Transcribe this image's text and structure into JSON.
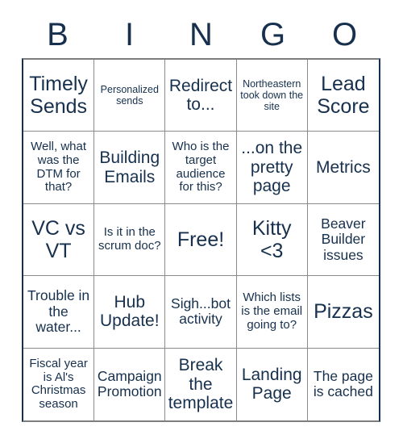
{
  "card": {
    "title": "BINGO",
    "text_color": "#16304d",
    "grid_line_color": "#8a8a8a",
    "background": "#ffffff",
    "header_letters": [
      "B",
      "I",
      "N",
      "G",
      "O"
    ],
    "columns": 5,
    "rows": 5,
    "cells": [
      {
        "text": "Timely Sends",
        "size": "xl"
      },
      {
        "text": "Personalized sends",
        "size": "xs"
      },
      {
        "text": "Redirect to...",
        "size": "l"
      },
      {
        "text": "Northeastern took down the site",
        "size": "xs"
      },
      {
        "text": "Lead Score",
        "size": "xl"
      },
      {
        "text": "Well, what was the DTM for that?",
        "size": "s"
      },
      {
        "text": "Building Emails",
        "size": "l"
      },
      {
        "text": "Who is the target audience for this?",
        "size": "s"
      },
      {
        "text": "...on the pretty page",
        "size": "l"
      },
      {
        "text": "Metrics",
        "size": "l"
      },
      {
        "text": "VC vs VT",
        "size": "xl"
      },
      {
        "text": "Is it in the scrum doc?",
        "size": "s"
      },
      {
        "text": "Free!",
        "size": "xl"
      },
      {
        "text": "Kitty <3",
        "size": "xl"
      },
      {
        "text": "Beaver Builder issues",
        "size": "m"
      },
      {
        "text": "Trouble in the water...",
        "size": "m"
      },
      {
        "text": "Hub Update!",
        "size": "l"
      },
      {
        "text": "Sigh...bot activity",
        "size": "m"
      },
      {
        "text": "Which lists is the email going to?",
        "size": "s"
      },
      {
        "text": "Pizzas",
        "size": "xl"
      },
      {
        "text": "Fiscal year is Al's Christmas season",
        "size": "s"
      },
      {
        "text": "Campaign Promotion",
        "size": "m"
      },
      {
        "text": "Break the template",
        "size": "l"
      },
      {
        "text": "Landing Page",
        "size": "l"
      },
      {
        "text": "The page is cached",
        "size": "m"
      }
    ]
  }
}
